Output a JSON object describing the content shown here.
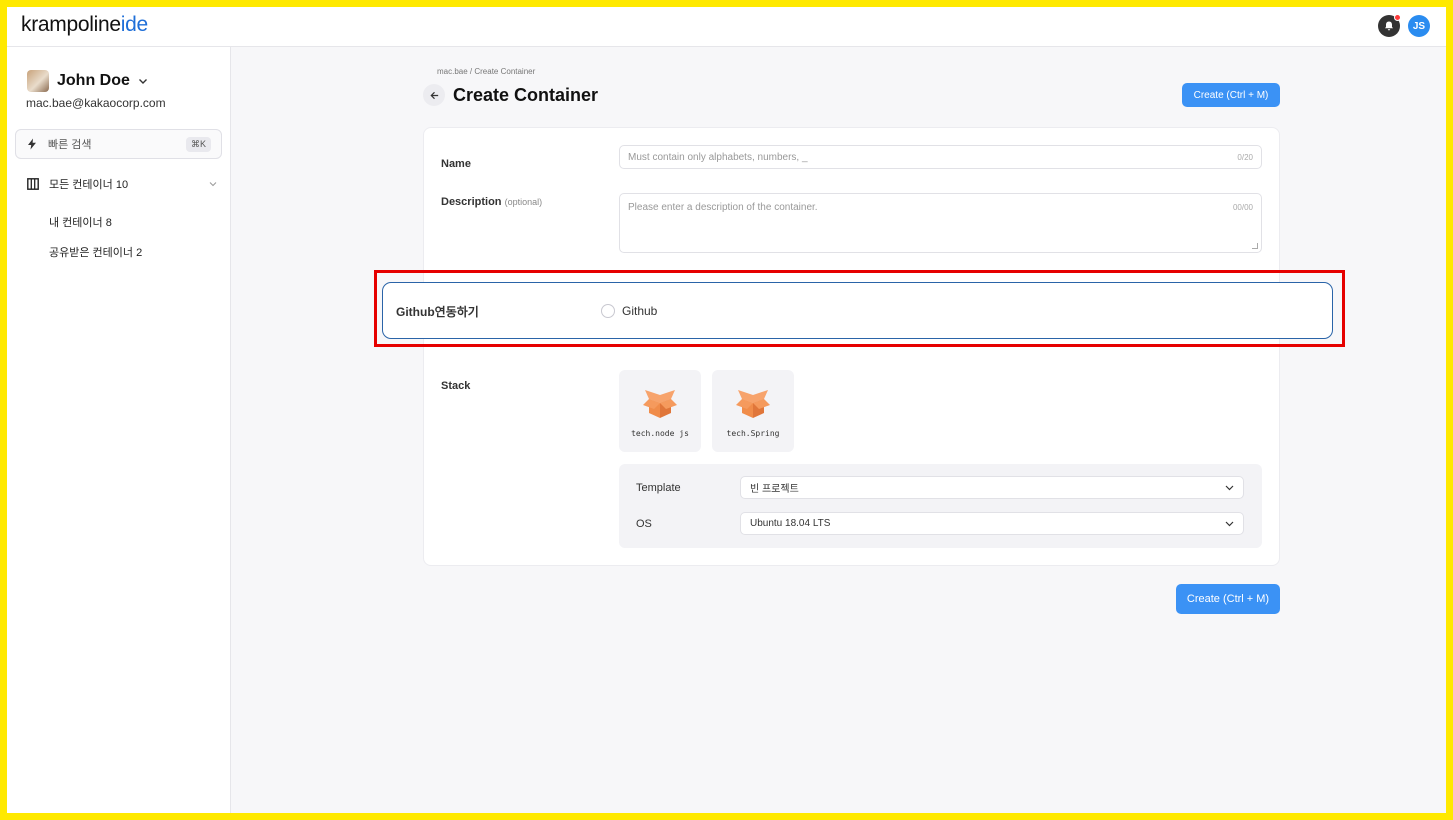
{
  "app": {
    "logo_main": "krampoline",
    "logo_accent": "ide",
    "user_initials": "JS"
  },
  "sidebar": {
    "user_name": "John Doe",
    "user_email": "mac.bae@kakaocorp.com",
    "search_label": "빠른 검색",
    "search_shortcut": "⌘K",
    "group_label": "모든 컨테이너 10",
    "items": [
      {
        "label": "내 컨테이너 8"
      },
      {
        "label": "공유받은 컨테이너 2"
      }
    ]
  },
  "header": {
    "breadcrumb": "mac.bae  /  Create Container",
    "title": "Create Container",
    "create_label": "Create (Ctrl + M)"
  },
  "form": {
    "name_label": "Name",
    "name_placeholder": "Must contain only alphabets, numbers, _",
    "name_counter": "0/20",
    "description_label": "Description",
    "description_optional": "(optional)",
    "description_placeholder": "Please enter a description of the container.",
    "description_counter": "00/00",
    "github_label": "Github연동하기",
    "github_option": "Github",
    "stack_label": "Stack",
    "stacks": [
      {
        "name": "tech.node js"
      },
      {
        "name": "tech.Spring"
      }
    ],
    "template_label": "Template",
    "template_value": "빈 프로젝트",
    "os_label": "OS",
    "os_value": "Ubuntu 18.04 LTS",
    "submit_label": "Create (Ctrl + M)"
  },
  "colors": {
    "accent": "#3b92f5",
    "highlight": "#e60000",
    "stack_icon": "#f08c4a"
  }
}
